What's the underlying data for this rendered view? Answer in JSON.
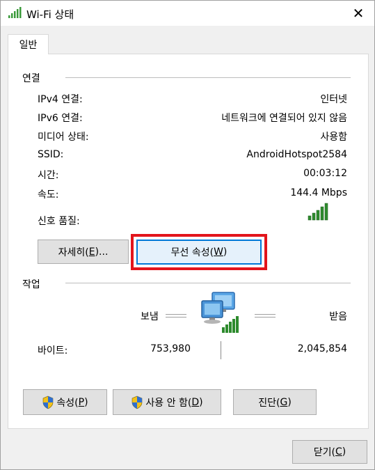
{
  "window": {
    "title": "Wi-Fi 상태",
    "close_glyph": "✕"
  },
  "tabs": [
    {
      "label": "일반",
      "selected": true
    }
  ],
  "connection": {
    "title": "연결",
    "rows": [
      {
        "label": "IPv4 연결:",
        "value": "인터넷"
      },
      {
        "label": "IPv6 연결:",
        "value": "네트워크에 연결되어 있지 않음"
      },
      {
        "label": "미디어 상태:",
        "value": "사용함"
      },
      {
        "label": "SSID:",
        "value": "AndroidHotspot2584"
      },
      {
        "label": "시간:",
        "value": "00:03:12"
      },
      {
        "label": "속도:",
        "value": "144.4 Mbps"
      }
    ],
    "signal_label": "신호 품질:",
    "signal_bars": 5,
    "details_button": {
      "text": "자세히(",
      "mnemonic": "E",
      "suffix": ")..."
    },
    "wireless_props_button": {
      "text": "무선 속성(",
      "mnemonic": "W",
      "suffix": ")"
    }
  },
  "activity": {
    "title": "작업",
    "sent_label": "보냄",
    "received_label": "받음",
    "bytes_label": "바이트:",
    "bytes_sent": "753,980",
    "bytes_received": "2,045,854"
  },
  "actions": {
    "properties": {
      "text": "속성(",
      "mnemonic": "P",
      "suffix": ")"
    },
    "disable": {
      "text": "사용 안 함(",
      "mnemonic": "D",
      "suffix": ")"
    },
    "diagnose": {
      "text": "진단(",
      "mnemonic": "G",
      "suffix": ")"
    }
  },
  "footer": {
    "close": {
      "text": "닫기(",
      "mnemonic": "C",
      "suffix": ")"
    }
  },
  "colors": {
    "signal_green": "#2e8b2e",
    "highlight_red": "#e2151c",
    "focus_blue": "#0078d7"
  }
}
